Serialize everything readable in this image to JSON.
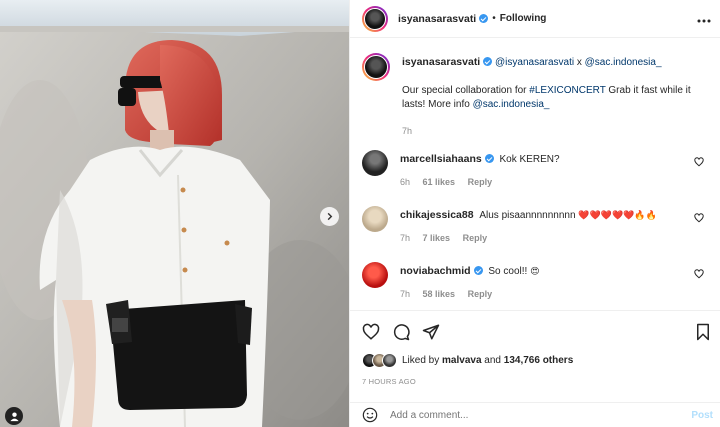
{
  "header": {
    "username": "isyanasarasvati",
    "separator": "•",
    "follow_status": "Following",
    "more_icon": "more-horizontal-icon"
  },
  "caption": {
    "username": "isyanasarasvati",
    "mention1": "@isyanasarasvati",
    "x": "x",
    "mention2": "@sac.indonesia_",
    "text1": "Our special collaboration for",
    "hashtag": "#LEXICONCERT",
    "text2": "Grab it fast while it lasts! More info",
    "mention3": "@sac.indonesia_",
    "time": "7h"
  },
  "comments": [
    {
      "username": "marcellsiahaans",
      "verified": true,
      "text": "Kok KEREN?",
      "time": "6h",
      "likes": "61 likes",
      "reply": "Reply"
    },
    {
      "username": "chikajessica88",
      "verified": false,
      "text": "Alus pisaannnnnnnnn",
      "emoji": "❤️❤️❤️❤️❤️🔥🔥",
      "time": "7h",
      "likes": "7 likes",
      "reply": "Reply"
    },
    {
      "username": "noviabachmid",
      "verified": true,
      "text": "So cool!!",
      "emoji": "😍",
      "time": "7h",
      "likes": "58 likes",
      "reply": "Reply"
    }
  ],
  "actions": {
    "liked_by_prefix": "Liked by",
    "liked_by_user": "malvava",
    "liked_by_and": "and",
    "liked_by_count": "134,766 others",
    "time_ago": "7 HOURS AGO"
  },
  "add_comment": {
    "placeholder": "Add a comment...",
    "post_label": "Post"
  },
  "colors": {
    "accent": "#3897f0",
    "link": "#00376b",
    "muted": "#8e8e8e",
    "hair": "#c93b33"
  }
}
